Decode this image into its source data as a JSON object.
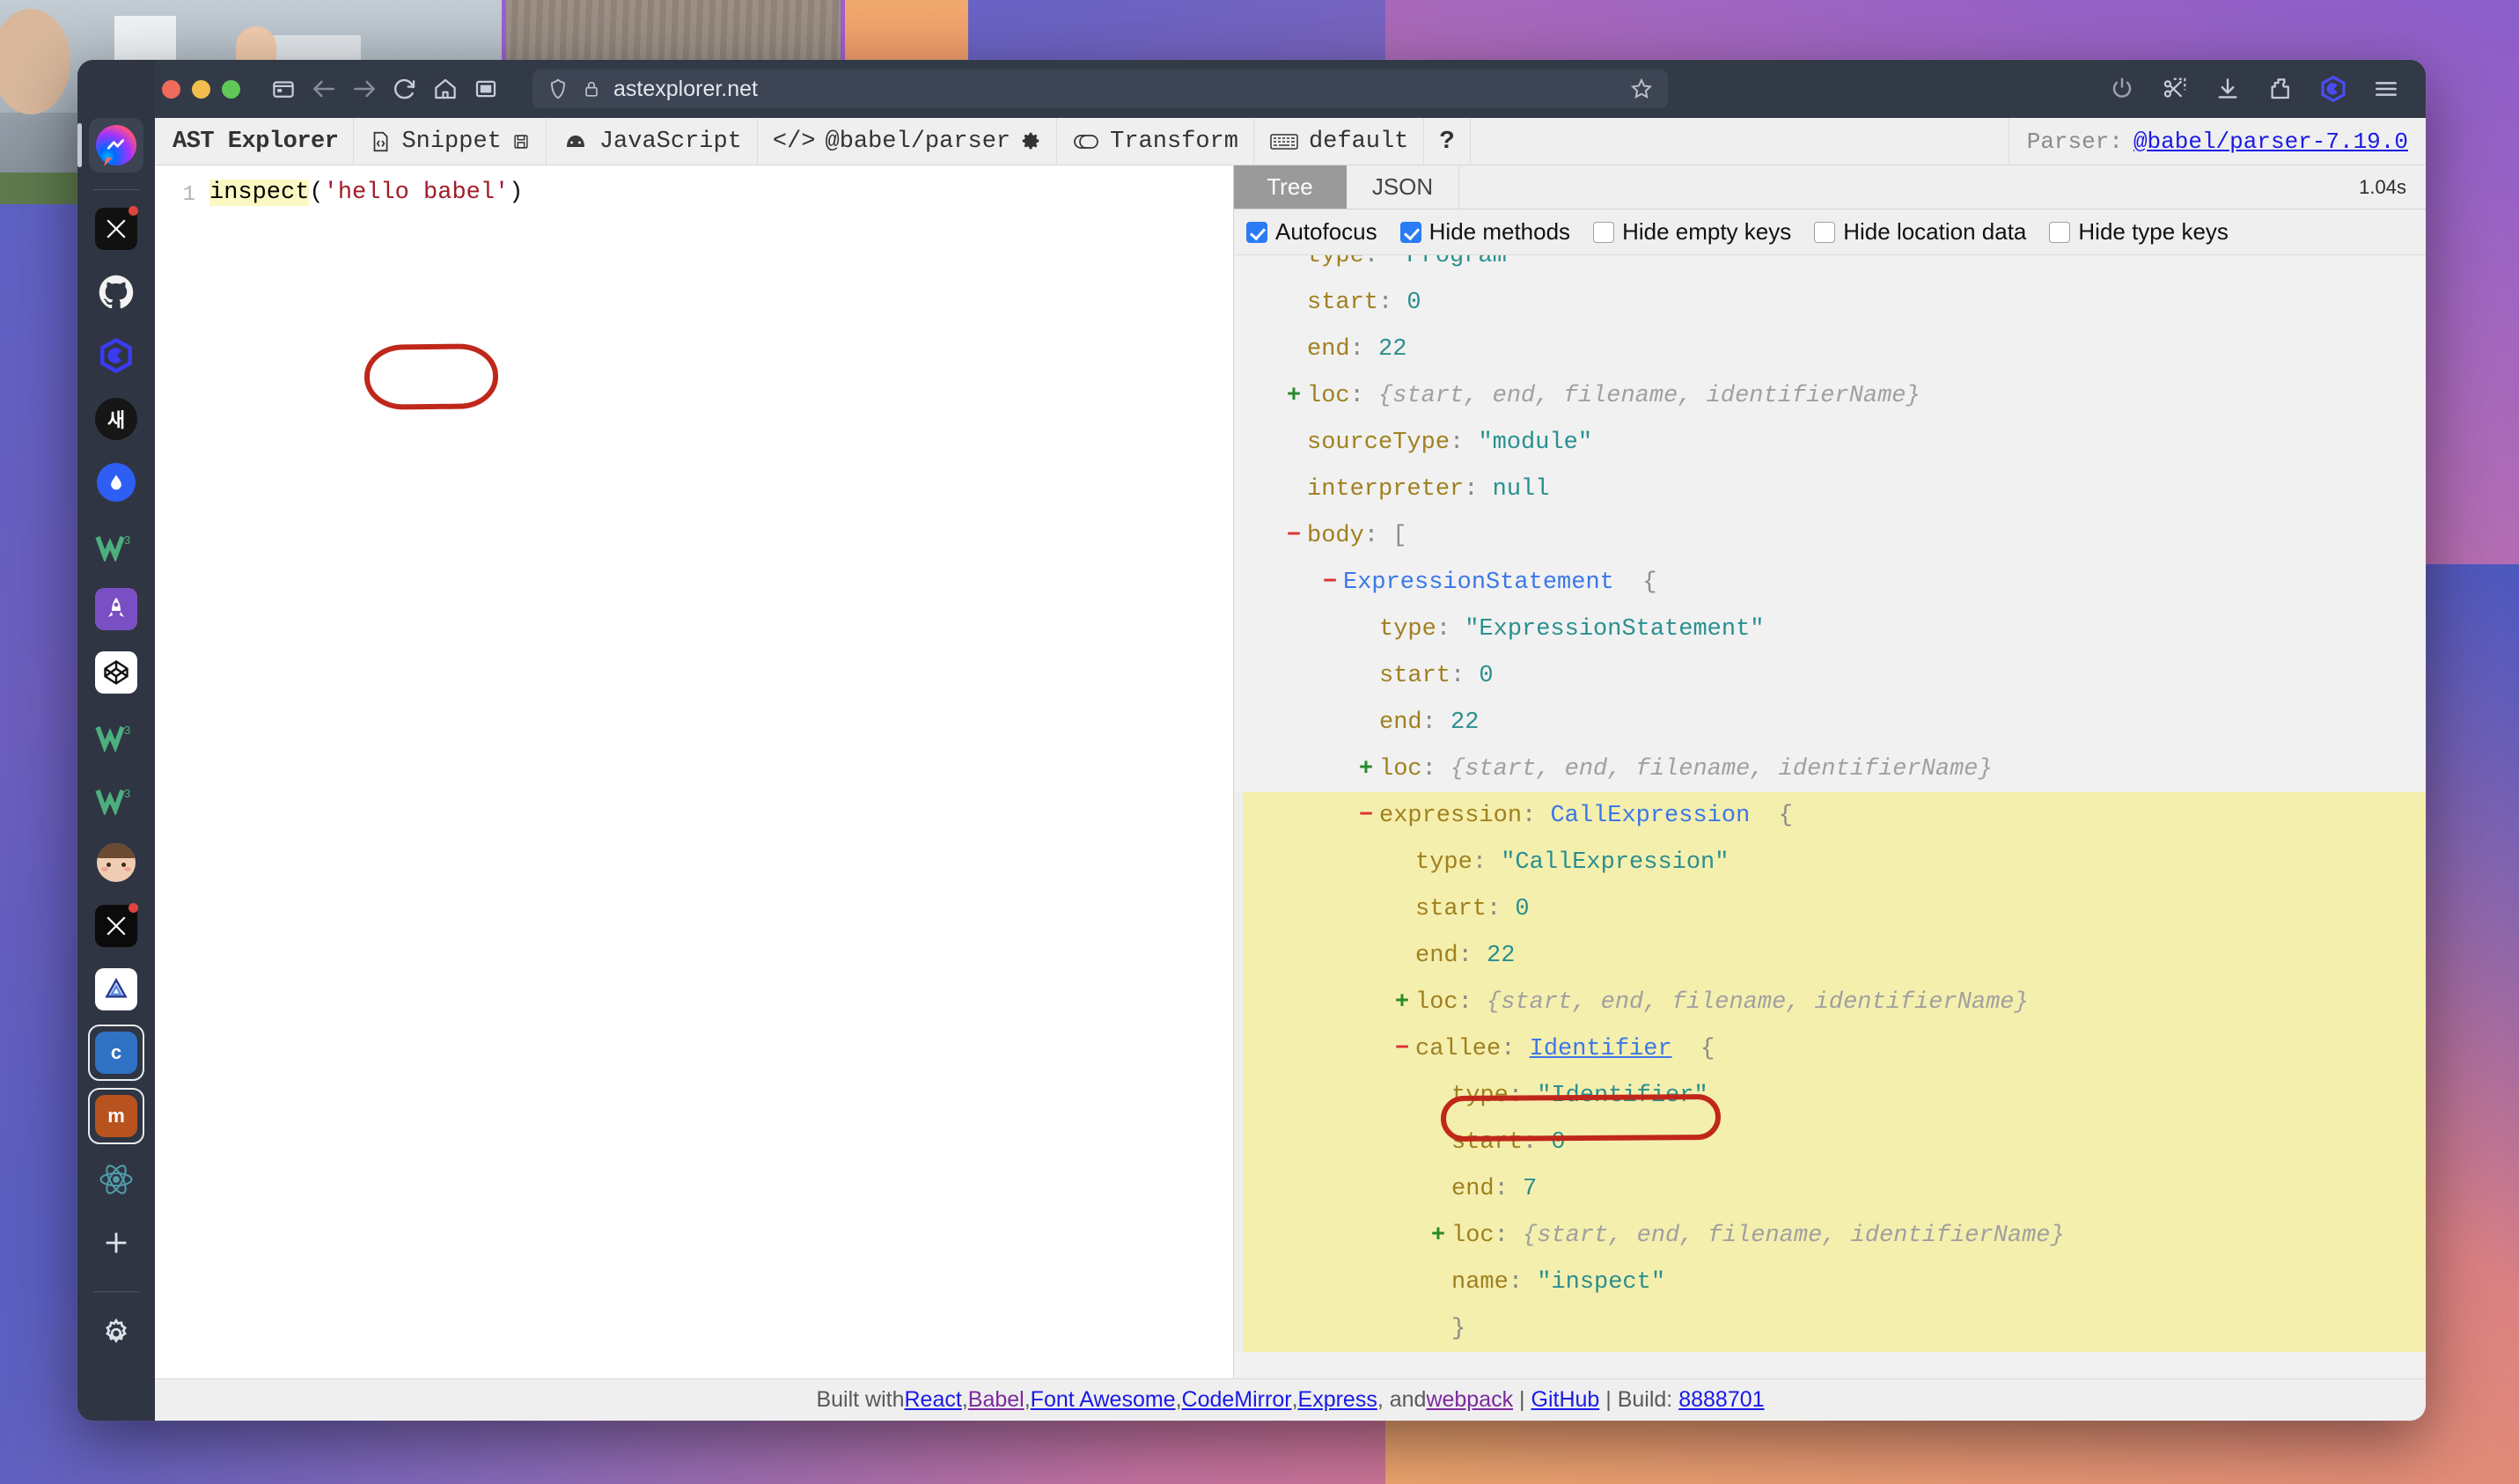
{
  "desktop": {
    "wallpaper_colors": [
      "#4a55b5",
      "#8a6ab8",
      "#d2768f",
      "#e8a271"
    ]
  },
  "browser": {
    "window_controls": {
      "close": "close-window",
      "minimize": "minimize-window",
      "maximize": "maximize-window"
    },
    "nav": {
      "sidebar_toggle_icon": "sidebar-panel-icon",
      "back_icon": "arrow-left-icon",
      "forward_icon": "arrow-right-icon",
      "reload_icon": "reload-icon",
      "home_icon": "home-icon",
      "split_view_icon": "split-view-icon"
    },
    "url_bar": {
      "shield_icon": "shield-icon",
      "lock_icon": "lock-icon",
      "url": "astexplorer.net",
      "bookmark_icon": "star-outline-icon"
    },
    "right_tools": [
      {
        "icon": "power-icon"
      },
      {
        "icon": "screenshot-scissors-icon"
      },
      {
        "icon": "download-icon"
      },
      {
        "icon": "extension-puzzle-icon"
      },
      {
        "icon": "hexagon-logo-icon"
      },
      {
        "icon": "hamburger-menu-icon"
      }
    ]
  },
  "dock": {
    "items": [
      {
        "name": "messenger",
        "icon": "messenger-icon",
        "selected": true,
        "badge": false
      },
      {
        "name": "x-twitter-1",
        "icon": "x-logo-icon",
        "badge": true,
        "label": ""
      },
      {
        "name": "github",
        "icon": "github-icon",
        "badge": false
      },
      {
        "name": "hexagon-app",
        "icon": "hexagon-logo-icon",
        "badge": false
      },
      {
        "name": "korean-news",
        "icon": "korean-character-icon",
        "label": "새",
        "badge": false
      },
      {
        "name": "water-drop-app",
        "icon": "droplet-icon",
        "badge": false
      },
      {
        "name": "w3schools-1",
        "icon": "w3-icon",
        "label": "W",
        "sup": "3",
        "badge": false
      },
      {
        "name": "rocket-app",
        "icon": "rocket-icon",
        "badge": false
      },
      {
        "name": "codepen",
        "icon": "codepen-icon",
        "badge": false
      },
      {
        "name": "w3schools-2",
        "icon": "w3-icon",
        "label": "W",
        "sup": "3",
        "badge": false
      },
      {
        "name": "w3schools-3",
        "icon": "w3-icon",
        "label": "W",
        "sup": "3",
        "badge": false
      },
      {
        "name": "avatar-profile",
        "icon": "avatar-icon",
        "badge": false
      },
      {
        "name": "x-twitter-2",
        "icon": "x-logo-icon",
        "badge": true
      },
      {
        "name": "triangle-app",
        "icon": "triangle-logo-icon",
        "badge": false
      },
      {
        "name": "workspace-c",
        "icon": "letter-tile-icon",
        "label": "c",
        "color": "#2f72c4",
        "selected": true
      },
      {
        "name": "workspace-m",
        "icon": "letter-tile-icon",
        "label": "m",
        "color": "#b8521e"
      },
      {
        "name": "react-app",
        "icon": "react-atom-icon",
        "badge": false
      },
      {
        "name": "add-workspace",
        "icon": "plus-icon",
        "label": "+"
      },
      {
        "name": "settings",
        "icon": "gear-icon"
      }
    ]
  },
  "app": {
    "brand": "AST Explorer",
    "header_items": [
      {
        "name": "snippet",
        "icon": "code-file-icon",
        "label": "Snippet",
        "trailing_icon": "save-floppy-icon"
      },
      {
        "name": "language",
        "icon": "babel-logo-icon",
        "label": "JavaScript"
      },
      {
        "name": "parser",
        "icon": "code-brackets-icon",
        "label": "@babel/parser",
        "trailing_icon": "gear-icon"
      },
      {
        "name": "transform",
        "icon": "toggle-off-icon",
        "label": "Transform"
      },
      {
        "name": "keymap",
        "icon": "keyboard-icon",
        "label": "default"
      },
      {
        "name": "help",
        "icon": "question-mark-icon",
        "label": "?"
      }
    ],
    "parser_status": {
      "label": "Parser:",
      "version_link": "@babel/parser-7.19.0"
    }
  },
  "editor": {
    "lines": [
      {
        "number": "1",
        "segments": [
          {
            "text": "inspect",
            "style": "highlight"
          },
          {
            "text": "(",
            "style": "plain"
          },
          {
            "text": "'hello babel'",
            "style": "string"
          },
          {
            "text": ")",
            "style": "plain"
          }
        ]
      }
    ]
  },
  "annotations": [
    {
      "name": "inspect-callout",
      "shape": "oval",
      "color": "#c0271a",
      "target": "inspect"
    },
    {
      "name": "type-identifier-callout",
      "shape": "rounded-rect",
      "color": "#c0271a",
      "target": "type: \"Identifier\""
    }
  ],
  "right_panel": {
    "tabs": [
      {
        "name": "tab-tree",
        "label": "Tree",
        "active": true
      },
      {
        "name": "tab-json",
        "label": "JSON",
        "active": false
      }
    ],
    "parse_time": "1.04s",
    "options": [
      {
        "name": "autofocus",
        "label": "Autofocus",
        "checked": true
      },
      {
        "name": "hide-methods",
        "label": "Hide methods",
        "checked": true
      },
      {
        "name": "hide-empty-keys",
        "label": "Hide empty keys",
        "checked": false
      },
      {
        "name": "hide-location-data",
        "label": "Hide location data",
        "checked": false
      },
      {
        "name": "hide-type-keys",
        "label": "Hide type keys",
        "checked": false
      }
    ],
    "tree": [
      {
        "indent": 1,
        "toggle": "none",
        "key": "type",
        "value": "\"Program\"",
        "vtype": "str"
      },
      {
        "indent": 1,
        "toggle": "none",
        "key": "start",
        "value": "0",
        "vtype": "num"
      },
      {
        "indent": 1,
        "toggle": "none",
        "key": "end",
        "value": "22",
        "vtype": "num"
      },
      {
        "indent": 1,
        "toggle": "plus",
        "key": "loc",
        "value": "{start, end, filename, identifierName}",
        "vtype": "preview"
      },
      {
        "indent": 1,
        "toggle": "none",
        "key": "sourceType",
        "value": "\"module\"",
        "vtype": "str"
      },
      {
        "indent": 1,
        "toggle": "none",
        "key": "interpreter",
        "value": "null",
        "vtype": "null"
      },
      {
        "indent": 1,
        "toggle": "minus",
        "key": "body",
        "value": "[",
        "vtype": "brace"
      },
      {
        "indent": 2,
        "toggle": "minus",
        "key": "",
        "nodetype": "ExpressionStatement",
        "value": "{",
        "vtype": "brace"
      },
      {
        "indent": 3,
        "toggle": "none",
        "key": "type",
        "value": "\"ExpressionStatement\"",
        "vtype": "str"
      },
      {
        "indent": 3,
        "toggle": "none",
        "key": "start",
        "value": "0",
        "vtype": "num"
      },
      {
        "indent": 3,
        "toggle": "none",
        "key": "end",
        "value": "22",
        "vtype": "num"
      },
      {
        "indent": 3,
        "toggle": "plus",
        "key": "loc",
        "value": "{start, end, filename, identifierName}",
        "vtype": "preview"
      },
      {
        "indent": 3,
        "toggle": "minus",
        "key": "expression",
        "nodetype": "CallExpression",
        "value": "{",
        "vtype": "brace",
        "highlight": true
      },
      {
        "indent": 4,
        "toggle": "none",
        "key": "type",
        "value": "\"CallExpression\"",
        "vtype": "str",
        "highlight": true
      },
      {
        "indent": 4,
        "toggle": "none",
        "key": "start",
        "value": "0",
        "vtype": "num",
        "highlight": true
      },
      {
        "indent": 4,
        "toggle": "none",
        "key": "end",
        "value": "22",
        "vtype": "num",
        "highlight": true
      },
      {
        "indent": 4,
        "toggle": "plus",
        "key": "loc",
        "value": "{start, end, filename, identifierName}",
        "vtype": "preview",
        "highlight": true
      },
      {
        "indent": 4,
        "toggle": "minus",
        "key": "callee",
        "nodetype": "Identifier",
        "value": "{",
        "vtype": "brace",
        "highlight": true,
        "underline": true
      },
      {
        "indent": 5,
        "toggle": "none",
        "key": "type",
        "value": "\"Identifier\"",
        "vtype": "str",
        "highlight": true,
        "annotated": true
      },
      {
        "indent": 5,
        "toggle": "none",
        "key": "start",
        "value": "0",
        "vtype": "num",
        "highlight": true
      },
      {
        "indent": 5,
        "toggle": "none",
        "key": "end",
        "value": "7",
        "vtype": "num",
        "highlight": true
      },
      {
        "indent": 5,
        "toggle": "plus",
        "key": "loc",
        "value": "{start, end, filename, identifierName}",
        "vtype": "preview",
        "highlight": true
      },
      {
        "indent": 5,
        "toggle": "none",
        "key": "name",
        "value": "\"inspect\"",
        "vtype": "str",
        "highlight": true
      },
      {
        "indent": 5,
        "toggle": "none",
        "key": "",
        "value": "}",
        "vtype": "brace",
        "highlight": true
      }
    ]
  },
  "footer": {
    "prefix": "Built with ",
    "links": [
      {
        "label": "React",
        "visited": false
      },
      {
        "label": "Babel",
        "visited": true
      },
      {
        "label": "Font Awesome",
        "visited": false
      },
      {
        "label": "CodeMirror",
        "visited": false
      },
      {
        "label": "Express",
        "visited": false
      },
      {
        "label": "webpack",
        "visited": true
      }
    ],
    "and_text": ", and ",
    "github_label": "GitHub",
    "build_label": "Build:",
    "build_hash": "8888701"
  }
}
